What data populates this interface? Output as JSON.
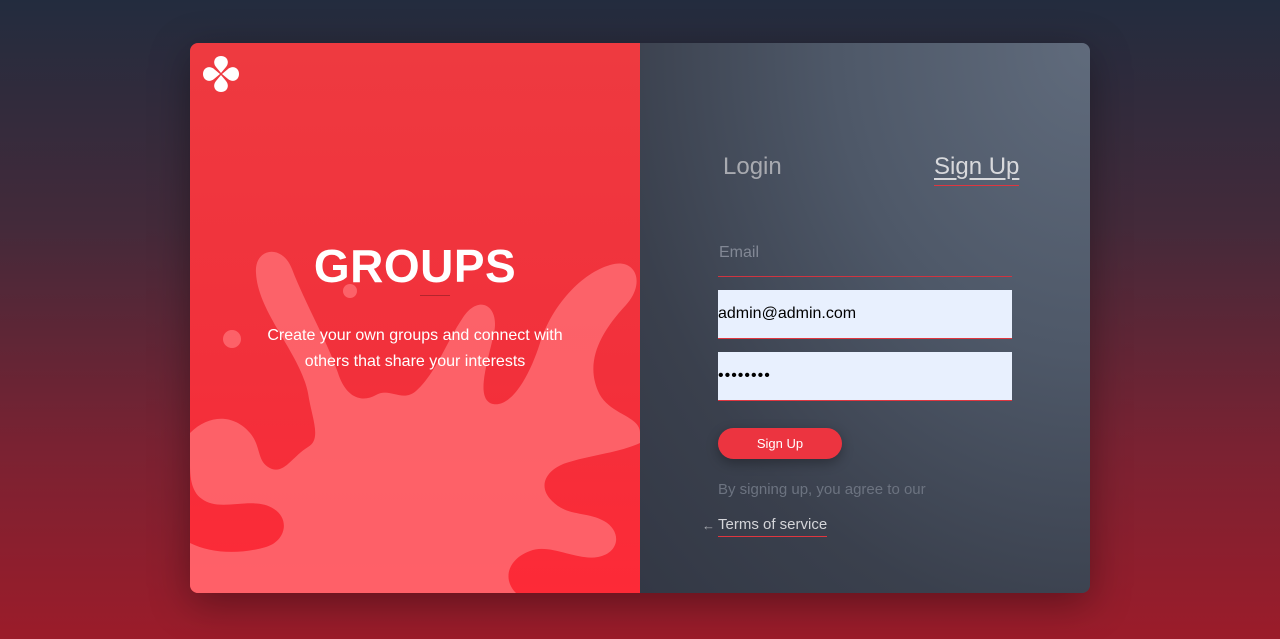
{
  "brand": {
    "title": "GROUPS",
    "description": "Create your own groups and connect with others that share your interests"
  },
  "icons": {
    "logo": "groups-logo-icon",
    "arrow": "arrow-left-icon"
  },
  "colors": {
    "accent": "#ec3440",
    "panel_red": "#f2303b",
    "panel_dark": "#3a404d",
    "input_bg": "#e8f0fe"
  },
  "tabs": [
    {
      "label": "Login",
      "active": false
    },
    {
      "label": "Sign Up",
      "active": true
    }
  ],
  "form": {
    "email_label": "Email",
    "email_value": "admin@admin.com",
    "password_value": "••••••••",
    "submit_label": "Sign Up",
    "agree_text": "By signing up, you agree to our",
    "terms_link": "Terms of service"
  }
}
